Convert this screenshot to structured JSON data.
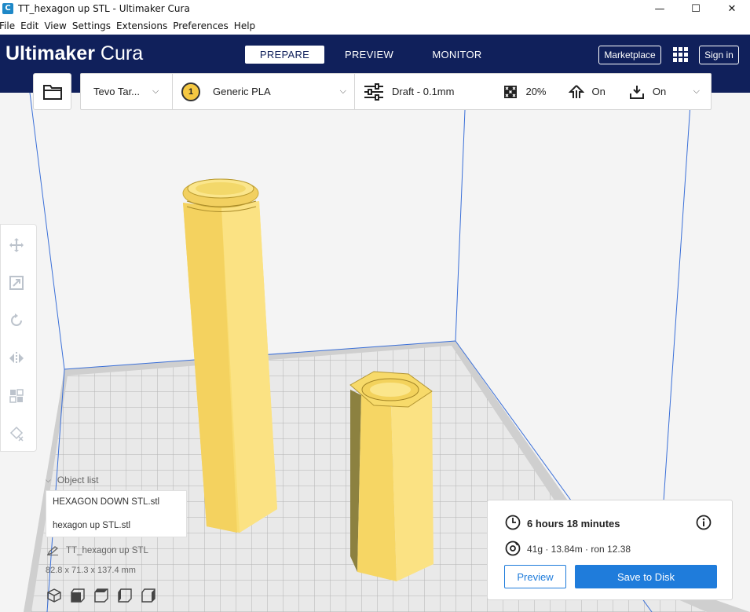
{
  "window": {
    "title": "TT_hexagon up STL - Ultimaker Cura",
    "minimize_glyph": "—",
    "maximize_glyph": "☐",
    "close_glyph": "✕"
  },
  "menu": {
    "items": [
      "File",
      "Edit",
      "View",
      "Settings",
      "Extensions",
      "Preferences",
      "Help"
    ]
  },
  "header": {
    "logo_brand": "Ultimaker",
    "logo_product": "Cura",
    "stages": [
      "PREPARE",
      "PREVIEW",
      "MONITOR"
    ],
    "active_stage": "PREPARE",
    "marketplace_label": "Marketplace",
    "signin_label": "Sign in"
  },
  "print_setup": {
    "printer": "Tevo Tar...",
    "extruder_number": "1",
    "material": "Generic PLA",
    "profile": "Draft - 0.1mm",
    "infill": "20%",
    "support": "On",
    "adhesion": "On"
  },
  "object_list": {
    "toggle_label": "Object list",
    "items": [
      "HEXAGON DOWN STL.stl",
      "hexagon up STL.stl"
    ],
    "selected_name": "TT_hexagon up STL",
    "dimensions": "82.8 x 71.3 x 137.4 mm"
  },
  "action_panel": {
    "print_time": "6 hours 18 minutes",
    "material_estimate": "41g · 13.84m · ron 12.38",
    "preview_label": "Preview",
    "save_label": "Save to Disk"
  },
  "colors": {
    "header_bg": "#10205b",
    "accent_blue": "#1f7cdb",
    "model_yellow": "#f9de6e",
    "plate_grey": "#c8c8c8"
  },
  "icons": {
    "app": "cura-icon",
    "open": "folder-icon",
    "profile": "sliders-icon",
    "infill": "infill-icon",
    "support": "support-icon",
    "adhesion": "adhesion-icon",
    "time": "clock-icon",
    "material": "spool-icon",
    "info": "info-icon"
  }
}
